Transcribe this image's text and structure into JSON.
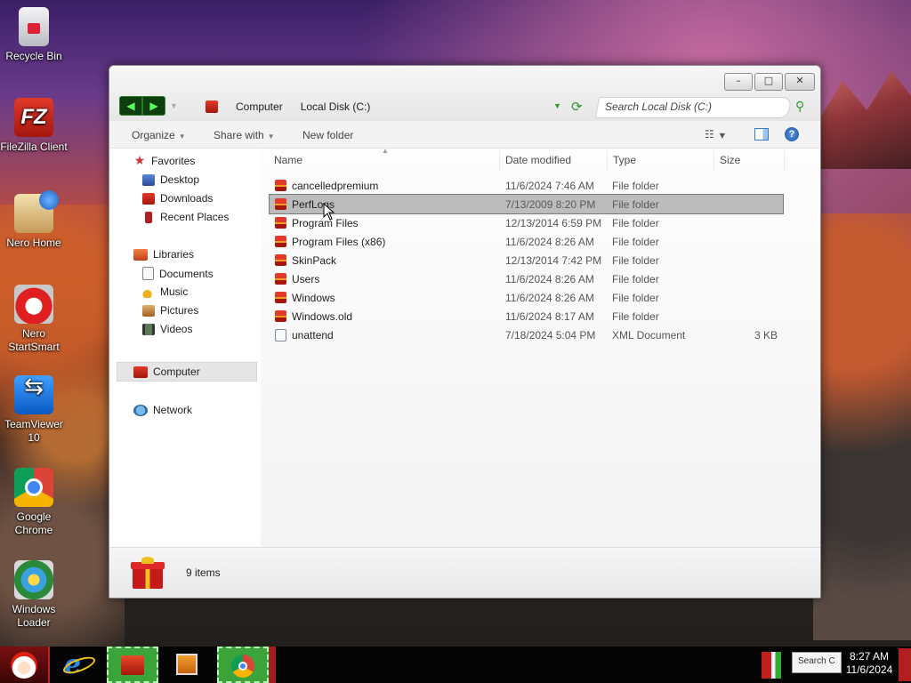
{
  "desktop": {
    "icons": [
      {
        "label": "Recycle Bin",
        "icon": "recycle-bin-icon"
      },
      {
        "label": "FileZilla Client",
        "icon": "filezilla-icon",
        "glyph": "FZ"
      },
      {
        "label": "Nero Home",
        "icon": "nero-home-icon"
      },
      {
        "label": "Nero StartSmart",
        "icon": "nero-startsmart-icon"
      },
      {
        "label": "TeamViewer 10",
        "icon": "teamviewer-icon"
      },
      {
        "label": "Google Chrome",
        "icon": "chrome-icon"
      },
      {
        "label": "Windows Loader",
        "icon": "windows-loader-icon"
      }
    ]
  },
  "window": {
    "controls": {
      "minimize": "–",
      "maximize": "□",
      "close": "✕"
    },
    "nav": {
      "back": "◀",
      "forward": "▶"
    },
    "breadcrumb": [
      "Computer",
      "Local Disk (C:)"
    ],
    "search_placeholder": "Search Local Disk (C:)",
    "toolbar": {
      "organize": "Organize",
      "share_with": "Share with",
      "new_folder": "New folder",
      "views_glyph": "☷"
    },
    "navpane": {
      "favorites": "Favorites",
      "desktop": "Desktop",
      "downloads": "Downloads",
      "recent_places": "Recent Places",
      "libraries": "Libraries",
      "documents": "Documents",
      "music": "Music",
      "pictures": "Pictures",
      "videos": "Videos",
      "computer": "Computer",
      "network": "Network"
    },
    "columns": {
      "name": "Name",
      "date": "Date modified",
      "type": "Type",
      "size": "Size"
    },
    "files": [
      {
        "name": "cancelledpremium",
        "date": "11/6/2024 7:46 AM",
        "type": "File folder",
        "size": "",
        "selected": false
      },
      {
        "name": "PerfLogs",
        "date": "7/13/2009 8:20 PM",
        "type": "File folder",
        "size": "",
        "selected": true
      },
      {
        "name": "Program Files",
        "date": "12/13/2014 6:59 PM",
        "type": "File folder",
        "size": "",
        "selected": false
      },
      {
        "name": "Program Files (x86)",
        "date": "11/6/2024 8:26 AM",
        "type": "File folder",
        "size": "",
        "selected": false
      },
      {
        "name": "SkinPack",
        "date": "12/13/2014 7:42 PM",
        "type": "File folder",
        "size": "",
        "selected": false
      },
      {
        "name": "Users",
        "date": "11/6/2024 8:26 AM",
        "type": "File folder",
        "size": "",
        "selected": false
      },
      {
        "name": "Windows",
        "date": "11/6/2024 8:26 AM",
        "type": "File folder",
        "size": "",
        "selected": false
      },
      {
        "name": "Windows.old",
        "date": "11/6/2024 8:17 AM",
        "type": "File folder",
        "size": "",
        "selected": false
      },
      {
        "name": "unattend",
        "date": "7/18/2024 5:04 PM",
        "type": "XML Document",
        "size": "3 KB",
        "selected": false
      }
    ],
    "status": "9 items"
  },
  "taskbar": {
    "tray_box": "Search C",
    "time": "8:27 AM",
    "date": "11/6/2024"
  }
}
